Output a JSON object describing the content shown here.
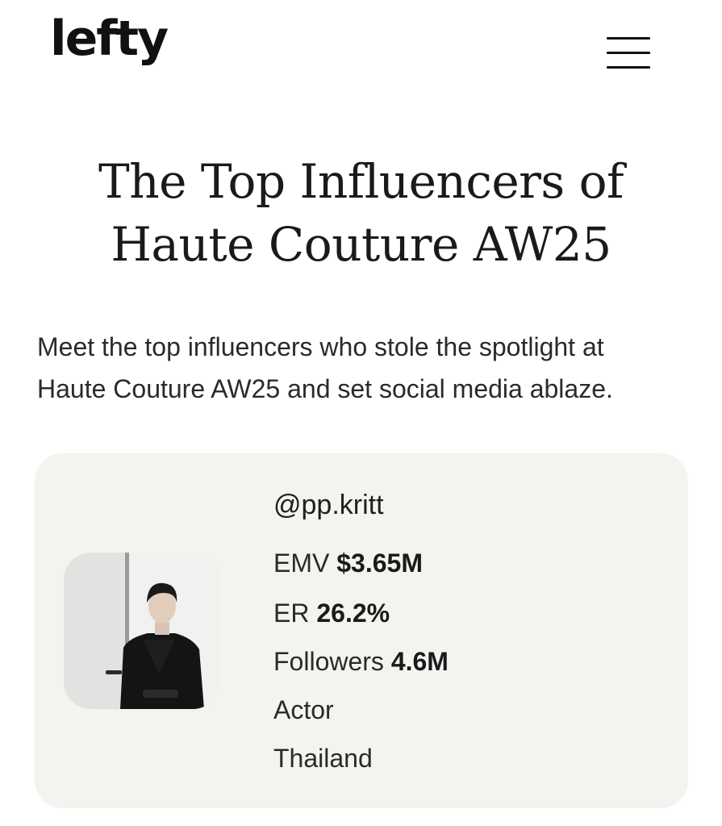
{
  "header": {
    "logo_text": "lefty",
    "menu_icon": "hamburger-menu-icon"
  },
  "hero": {
    "title_line1": "The Top Influencers of",
    "title_line2": "Haute Couture AW25",
    "intro_line1": "Meet the top influencers who stole the spotlight at",
    "intro_line2": "Haute Couture AW25 and set social media ablaze."
  },
  "influencer": {
    "handle": "@pp.kritt",
    "emv_label": "EMV",
    "emv_value": "$3.65M",
    "er_label": "ER",
    "er_value": "26.2%",
    "followers_label": "Followers",
    "followers_value": "4.6M",
    "occupation": "Actor",
    "country": "Thailand"
  },
  "colors": {
    "card_background": "#f4f3f0",
    "text_primary": "#1a1a1a"
  }
}
